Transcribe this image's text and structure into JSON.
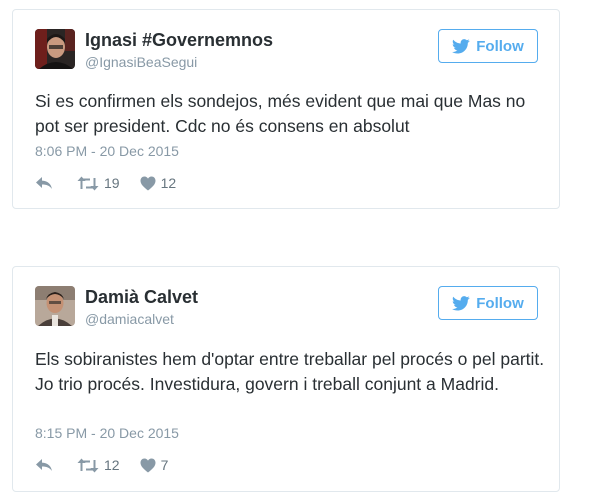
{
  "colors": {
    "accent": "#55acee",
    "text": "#292f33",
    "muted": "#8899a6",
    "border": "#e1e8ed"
  },
  "tweets": [
    {
      "name": "Ignasi #Governemnos",
      "handle": "@IgnasiBeaSegui",
      "follow_label": "Follow",
      "text": "Si es confirmen els sondejos, més evident que mai que Mas no pot ser president. Cdc no és consens en absolut",
      "timestamp": "8:06 PM - 20 Dec 2015",
      "retweets": "19",
      "likes": "12",
      "icons": [
        "avatar",
        "twitter-bird-icon",
        "reply-icon",
        "retweet-icon",
        "heart-icon"
      ]
    },
    {
      "name": "Damià Calvet",
      "handle": "@damiacalvet",
      "follow_label": "Follow",
      "text": "Els sobiranistes hem d'optar entre treballar pel procés o pel partit. Jo trio procés. Investidura, govern i treball conjunt a Madrid.",
      "timestamp": "8:15 PM - 20 Dec 2015",
      "retweets": "12",
      "likes": "7",
      "icons": [
        "avatar",
        "twitter-bird-icon",
        "reply-icon",
        "retweet-icon",
        "heart-icon"
      ]
    }
  ]
}
